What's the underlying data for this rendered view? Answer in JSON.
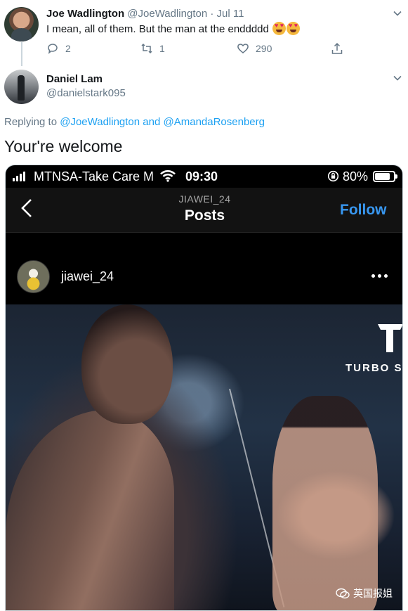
{
  "tweet1": {
    "author_name": "Joe Wadlington",
    "author_meta": "@JoeWadlington · Jul 11",
    "text": "I mean, all of them. But the man at the enddddd",
    "emojis": [
      "heart-eyes-emoji",
      "heart-eyes-emoji"
    ],
    "replies": "2",
    "retweets": "1",
    "likes": "290"
  },
  "tweet2": {
    "author_name": "Daniel Lam",
    "author_handle": "@danielstark095",
    "replying_prefix": "Replying to",
    "replying_to_1": "@JoeWadlington",
    "replying_and": "and",
    "replying_to_2": "@AmandaRosenberg",
    "text": "Your're welcome"
  },
  "screenshot": {
    "status": {
      "carrier": "MTNSA-Take Care M",
      "time": "09:30",
      "battery": "80%",
      "battery_level": 0.8
    },
    "nav": {
      "subtitle": "JIAWEI_24",
      "title": "Posts",
      "follow": "Follow"
    },
    "post": {
      "username": "jiawei_24",
      "brand_text": "TURBO S",
      "watermark": "英国报姐"
    }
  },
  "colors": {
    "link": "#1da1f2",
    "secondary_text": "#657786",
    "ig_follow": "#3897f0",
    "ig_background": "#000000"
  }
}
